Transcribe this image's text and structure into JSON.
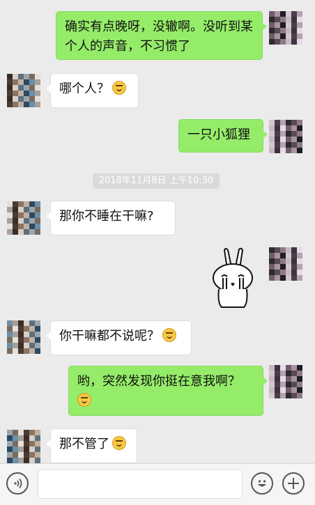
{
  "messages": [
    {
      "side": "out",
      "text": "确实有点晚呀，没辙啊。没听到某个人的声音，不习惯了",
      "emoji": null
    },
    {
      "side": "in",
      "text": "哪个人？",
      "emoji": "grin-face"
    },
    {
      "side": "out",
      "text": "一只小狐狸",
      "emoji": null
    },
    {
      "side": "in",
      "text": "那你不睡在干嘛?",
      "emoji": null
    },
    {
      "side": "out",
      "sticker": "crying-rabbit-sticker"
    },
    {
      "side": "in",
      "text": "你干嘛都不说呢？",
      "emoji": "smile-face"
    },
    {
      "side": "out",
      "text": "哟，突然发现你挺在意我啊？",
      "emoji": "grin-face"
    },
    {
      "side": "in",
      "text": "那不管了",
      "emoji": "embarrassed-face"
    }
  ],
  "timestamp": "2018年11月8日 上午10:30",
  "colors": {
    "background": "#ebebeb",
    "outgoing_bubble": "#95ec69",
    "incoming_bubble": "#ffffff"
  },
  "input_bar": {
    "placeholder": "",
    "voice_icon": "voice-icon",
    "emoji_icon": "emoji-icon",
    "plus_icon": "plus-icon"
  }
}
